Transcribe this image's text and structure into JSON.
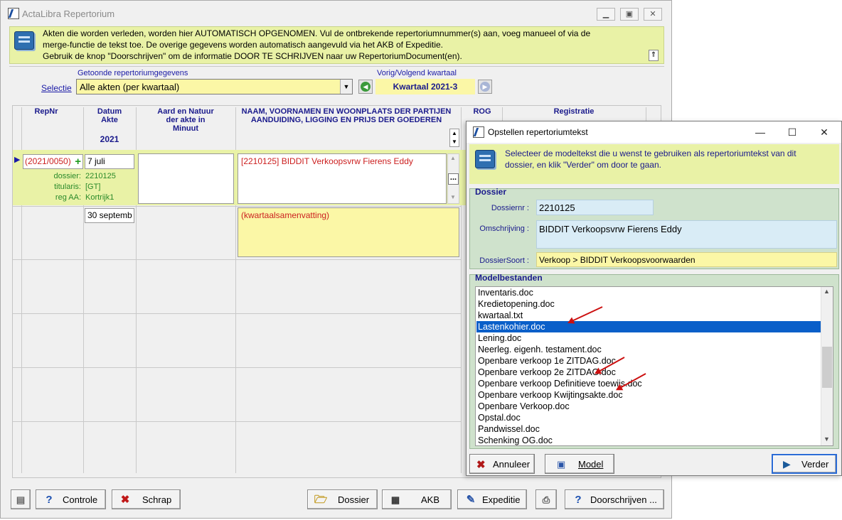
{
  "main": {
    "title": "ActaLibra Repertorium",
    "info_lines": [
      "Akten die worden verleden, worden hier AUTOMATISCH OPGENOMEN. Vul de ontbrekende repertoriumnummer(s) aan,  voeg manueel of via de",
      "merge-functie de tekst toe. De overige gegevens worden automatisch aangevuld via het AKB of Expeditie.",
      "Gebruik de knop \"Doorschrijven\" om de informatie DOOR TE SCHRIJVEN naar uw RepertoriumDocument(en)."
    ],
    "selection": {
      "caption": "Getoonde repertoriumgegevens",
      "label": "Selectie",
      "value": "Alle akten (per kwartaal)"
    },
    "quarter": {
      "caption": "Vorig/Volgend kwartaal",
      "value": "Kwartaal 2021-3"
    },
    "columns": {
      "repnr": "RepNr",
      "datum": "Datum\nAkte",
      "year": "2021",
      "aard": "Aard en Natuur\nder akte in\nMinuut",
      "naam": "NAAM, VOORNAMEN EN WOONPLAATS DER PARTIJEN\nAANDUIDING, LIGGING EN PRIJS DER GOEDEREN",
      "rog": "ROG",
      "registratie": "Registratie"
    },
    "row1": {
      "repnr": "(2021/0050)",
      "datum": "7 juli",
      "dossier_label": "dossier:",
      "dossier": "2210125",
      "titularis_label": "titularis:",
      "titularis": "[GT]",
      "regaa_label": "reg AA:",
      "regaa": "Kortrijk1",
      "naam": "[2210125] BIDDIT Verkoopsvrw Fierens Eddy",
      "more": "..."
    },
    "row2": {
      "datum": "30 septemb",
      "naam": "(kwartaalsamenvatting)"
    },
    "toolbar": {
      "controle": "Controle",
      "schrap": "Schrap",
      "dossier": "Dossier",
      "akb": "AKB",
      "expeditie": "Expeditie",
      "doorschrijven": "Doorschrijven ..."
    }
  },
  "dialog": {
    "title": "Opstellen repertoriumtekst",
    "info_lines": [
      "Selecteer de modeltekst die u wenst te gebruiken als repertoriumtekst van dit",
      "dossier, en klik \"Verder\" om door te gaan."
    ],
    "dossier_group": "Dossier",
    "dossiernr_label": "Dossiernr :",
    "dossiernr": "2210125",
    "omschrijving_label": "Omschrijving :",
    "omschrijving": "BIDDIT Verkoopsvrw Fierens Eddy",
    "dossiersoort_label": "DossierSoort :",
    "dossiersoort": "Verkoop > BIDDIT Verkoopsvoorwaarden",
    "models_group": "Modelbestanden",
    "files": [
      "Inventaris.doc",
      "Kredietopening.doc",
      "kwartaal.txt",
      "Lastenkohier.doc",
      "Lening.doc",
      "Neerleg. eigenh. testament.doc",
      "Openbare verkoop 1e ZITDAG.doc",
      "Openbare verkoop 2e ZITDAG.doc",
      "Openbare verkoop Definitieve toewijs.doc",
      "Openbare verkoop Kwijtingsakte.doc",
      "Openbare Verkoop.doc",
      "Opstal.doc",
      "Pandwissel.doc",
      "Schenking OG.doc"
    ],
    "selected_file": "Lastenkohier.doc",
    "buttons": {
      "annuleer": "Annuleer",
      "model": "Model",
      "verder": "Verder"
    }
  },
  "colors": {
    "info_bg": "#e9f2a6",
    "field_yellow": "#fbf7a6",
    "group_green": "#cfe2cc",
    "selection": "#0a5fc9",
    "header_text": "#1a1a8c",
    "error_red": "#cc2020"
  }
}
